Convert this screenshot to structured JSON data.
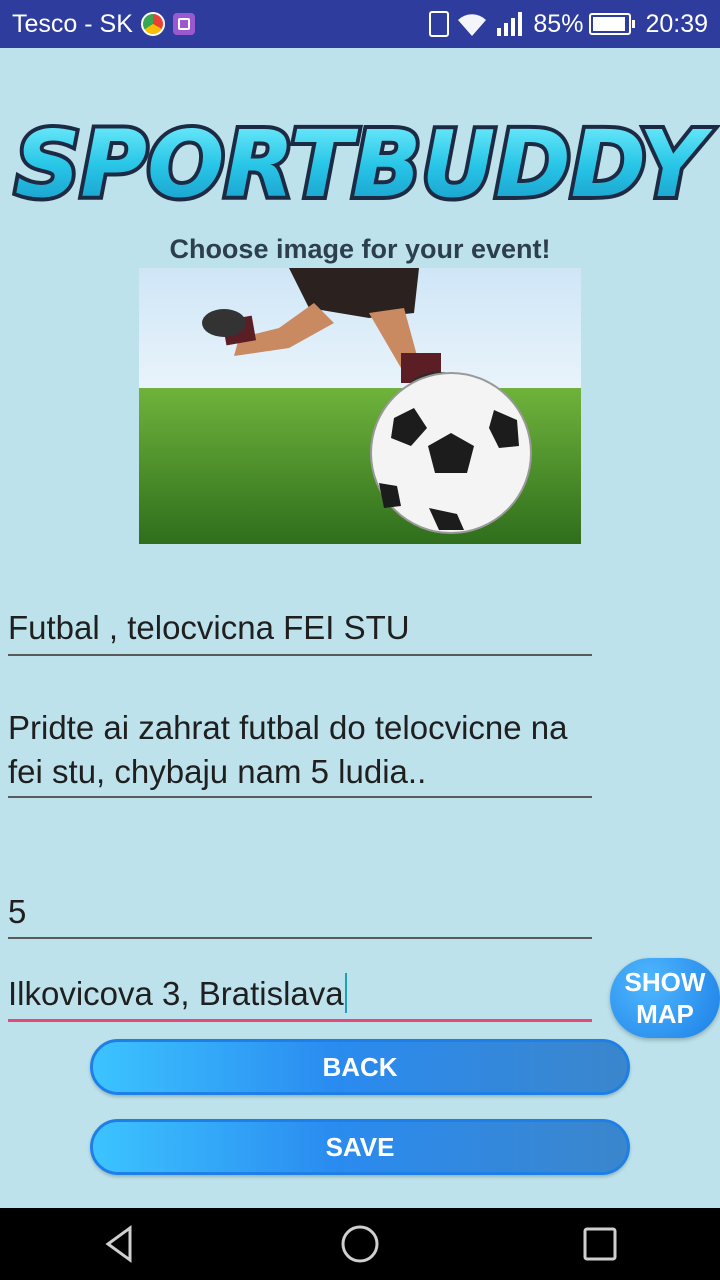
{
  "status_bar": {
    "carrier": "Tesco - SK",
    "battery": "85%",
    "time": "20:39",
    "icons": [
      "chrome-icon",
      "gallery-icon",
      "vibrate-icon",
      "wifi-icon",
      "signal-icon",
      "battery-icon"
    ]
  },
  "logo": {
    "text": "SPORTBUDDY"
  },
  "image_section": {
    "label": "Choose image for your event!",
    "image_description_icon": "soccer-ball-photo"
  },
  "form": {
    "title_value": "Futbal , telocvicna FEI STU",
    "description_value": "Pridte ai zahrat futbal do telocvicne na fei stu, chybaju nam 5 ludia..",
    "count_value": "5",
    "address_value": "Ilkovicova 3, Bratislava"
  },
  "buttons": {
    "show_map_line1": "SHOW",
    "show_map_line2": "MAP",
    "back": "BACK",
    "save": "SAVE"
  },
  "colors": {
    "background": "#bde2eb",
    "status_bar": "#2e3d9d",
    "button_blue": "#2a8bf0",
    "active_underline": "#e8477a"
  }
}
